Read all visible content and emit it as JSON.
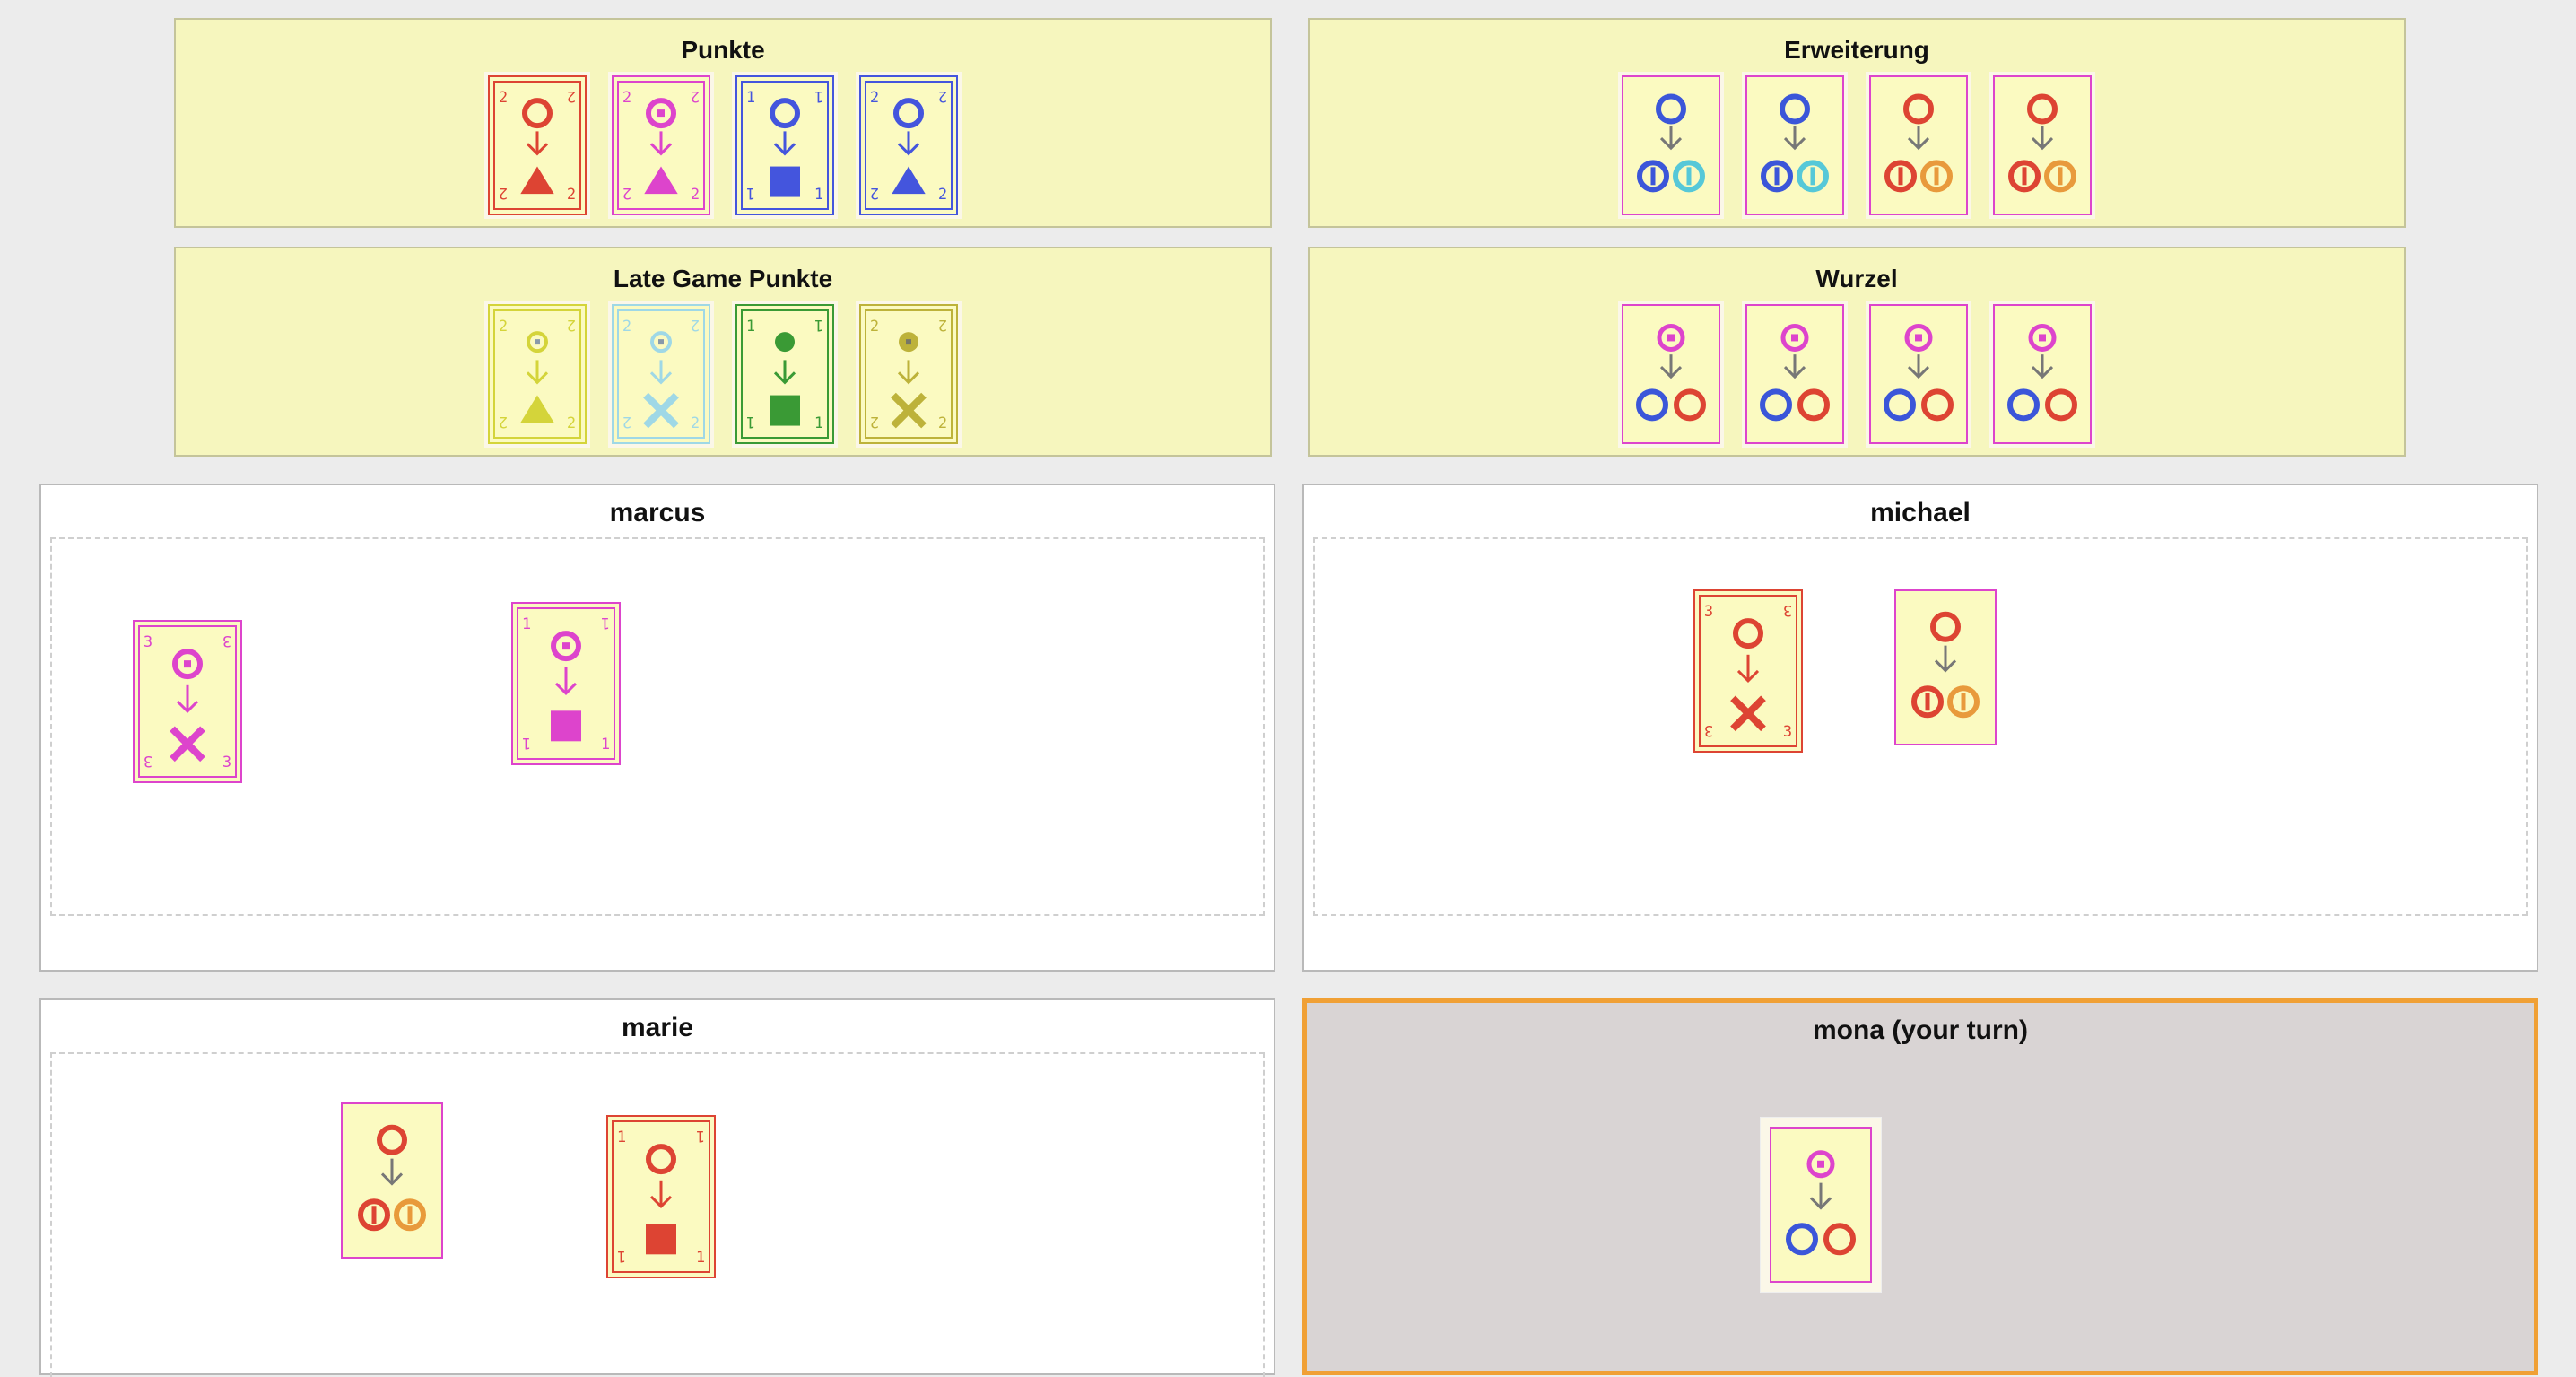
{
  "markets": [
    {
      "id": "punkte",
      "title": "Punkte",
      "cards": [
        {
          "kind": "number",
          "number": "2",
          "color": "#dd4433",
          "top": "circle",
          "bottom": "triangle"
        },
        {
          "kind": "number",
          "number": "2",
          "color": "#dd44cc",
          "top": "dotted-circle",
          "bottom": "triangle"
        },
        {
          "kind": "number",
          "number": "1",
          "color": "#4455dd",
          "top": "circle",
          "bottom": "square"
        },
        {
          "kind": "number",
          "number": "2",
          "color": "#4455dd",
          "top": "circle",
          "bottom": "triangle"
        }
      ]
    },
    {
      "id": "erweiterung",
      "title": "Erweiterung",
      "cards": [
        {
          "kind": "split",
          "color": "#dd44cc",
          "top_color": "#3b56d9",
          "left_color": "#3b56d9",
          "right_color": "#56c8d8"
        },
        {
          "kind": "split",
          "color": "#dd44cc",
          "top_color": "#3b56d9",
          "left_color": "#3b56d9",
          "right_color": "#56c8d8"
        },
        {
          "kind": "split",
          "color": "#dd44cc",
          "top_color": "#dd4433",
          "left_color": "#dd4433",
          "right_color": "#e89a3c"
        },
        {
          "kind": "split",
          "color": "#dd44cc",
          "top_color": "#dd4433",
          "left_color": "#dd4433",
          "right_color": "#e89a3c"
        }
      ]
    },
    {
      "id": "late-game-punkte",
      "title": "Late Game Punkte",
      "cards": [
        {
          "kind": "number",
          "number": "2",
          "color": "#d4d43a",
          "top": "small-dotted",
          "bottom": "triangle"
        },
        {
          "kind": "number",
          "number": "2",
          "color": "#9fd8e6",
          "top": "small-dotted",
          "bottom": "cross"
        },
        {
          "kind": "number",
          "number": "1",
          "color": "#3a9a35",
          "top": "octagon",
          "bottom": "square"
        },
        {
          "kind": "number",
          "number": "2",
          "color": "#bdb23a",
          "top": "octagon-dot",
          "bottom": "cross"
        }
      ]
    },
    {
      "id": "wurzel",
      "title": "Wurzel",
      "cards": [
        {
          "kind": "root",
          "color": "#dd44cc"
        },
        {
          "kind": "root",
          "color": "#dd44cc"
        },
        {
          "kind": "root",
          "color": "#dd44cc"
        },
        {
          "kind": "root",
          "color": "#dd44cc"
        }
      ]
    }
  ],
  "players": [
    {
      "id": "marcus",
      "name": "marcus",
      "cards": [
        {
          "kind": "number",
          "number": "3",
          "color": "#dd44cc",
          "top": "dotted-circle",
          "bottom": "cross"
        },
        {
          "kind": "number",
          "number": "1",
          "color": "#dd44cc",
          "top": "dotted-circle",
          "bottom": "square"
        }
      ]
    },
    {
      "id": "michael",
      "name": "michael",
      "cards": [
        {
          "kind": "number",
          "number": "3",
          "color": "#dd4433",
          "top": "circle",
          "bottom": "cross"
        },
        {
          "kind": "split",
          "color": "#dd44cc",
          "top_color": "#dd4433",
          "left_color": "#dd4433",
          "right_color": "#e89a3c"
        }
      ]
    },
    {
      "id": "marie",
      "name": "marie",
      "cards": [
        {
          "kind": "split",
          "color": "#dd44cc",
          "top_color": "#dd4433",
          "left_color": "#dd4433",
          "right_color": "#e89a3c"
        },
        {
          "kind": "number",
          "number": "1",
          "color": "#dd4433",
          "top": "circle",
          "bottom": "square"
        }
      ]
    },
    {
      "id": "mona",
      "name": "mona (your turn)",
      "active": true,
      "cards": [
        {
          "kind": "root",
          "color": "#dd44cc"
        }
      ]
    }
  ]
}
